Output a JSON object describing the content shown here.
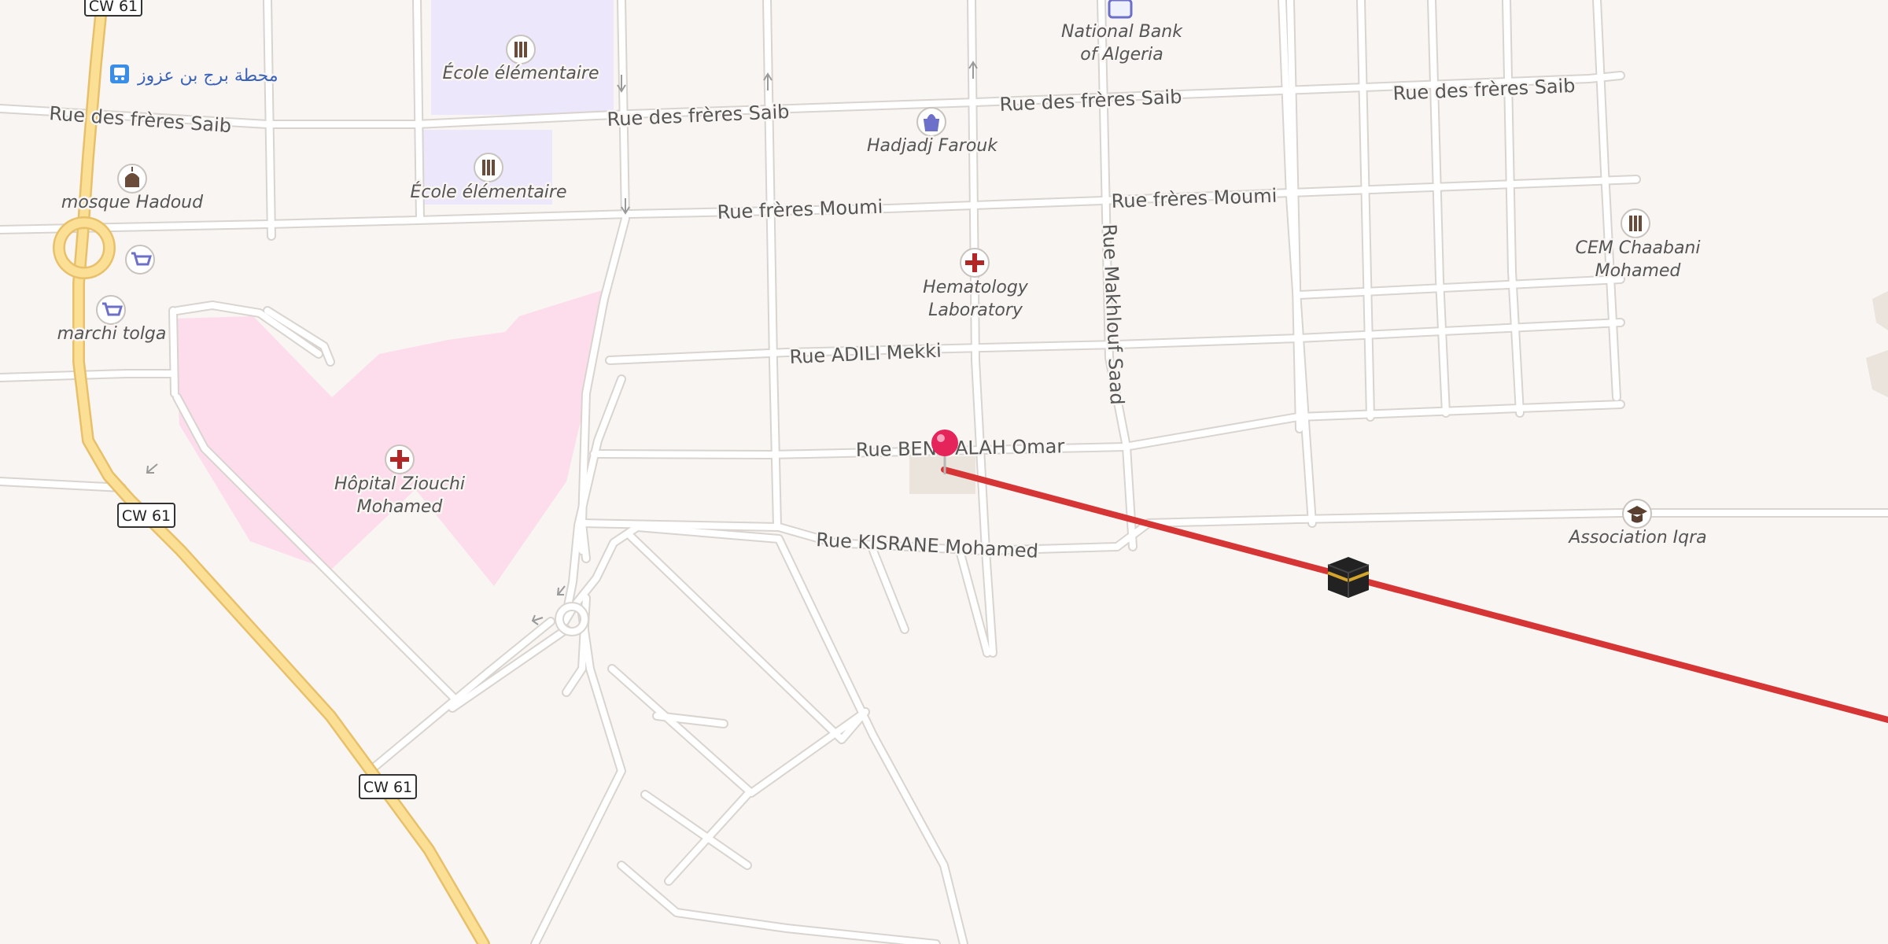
{
  "map": {
    "colors": {
      "background": "#f8f5f2",
      "road_minor": "#ffffff",
      "road_casing": "#d9d4cf",
      "road_primary": "#fbdf95",
      "road_primary_casing": "#e8c06a",
      "school_area": "#ece7fa",
      "hospital_area": "#fddcec",
      "qibla_line": "#d63535",
      "pin": "#e4245a"
    },
    "road_shields": [
      "CW 61",
      "CW 61",
      "CW 61"
    ],
    "bus_stop": {
      "label": "محطة برج بن عزوز",
      "icon": "bus-stop-icon"
    },
    "streets": [
      "Rue des frères Saib",
      "Rue des frères Saib",
      "Rue des frères Saib",
      "Rue frères Moumi",
      "Rue frères Moumi",
      "Rue Makhlouf Saad",
      "Rue ADILI Mekki",
      "Rue BEN SALAH Omar",
      "Rue KISRANE Mohamed"
    ],
    "pois": [
      {
        "name": "École élémentaire",
        "icon": "school-icon"
      },
      {
        "name": "École élémentaire",
        "icon": "school-icon"
      },
      {
        "name": "National Bank of Algeria",
        "line1": "National Bank",
        "line2": "of Algeria",
        "icon": "bank-icon"
      },
      {
        "name": "Hadjadj Farouk",
        "icon": "shopping-bag-icon"
      },
      {
        "name": "mosque Hadoud",
        "icon": "mosque-icon"
      },
      {
        "name": "marchi tolga",
        "icon": "cart-icon"
      },
      {
        "name": "Hematology Laboratory",
        "line1": "Hematology",
        "line2": "Laboratory",
        "icon": "medical-cross-icon"
      },
      {
        "name": "Hôpital Ziouchi Mohamed",
        "line1": "Hôpital Ziouchi",
        "line2": "Mohamed",
        "icon": "medical-cross-icon"
      },
      {
        "name": "CEM Chaabani Mohamed",
        "line1": "CEM Chaabani",
        "line2": "Mohamed",
        "icon": "school-icon"
      },
      {
        "name": "Association Iqra",
        "icon": "graduation-cap-icon"
      }
    ],
    "markers": {
      "location_pin": "location-pin-icon",
      "qibla": "kaaba-icon"
    }
  }
}
